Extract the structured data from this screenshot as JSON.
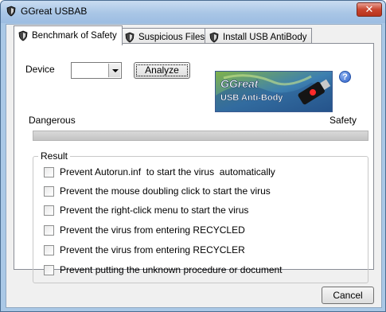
{
  "window": {
    "title": "GGreat USBAB",
    "close_glyph": "✕"
  },
  "tabs": [
    {
      "label": "Benchmark of Safety",
      "active": true,
      "icon": "shield-icon"
    },
    {
      "label": "Suspicious Files",
      "active": false,
      "icon": "shield-icon"
    },
    {
      "label": "Install USB AntiBody",
      "active": false,
      "icon": "shield-icon"
    }
  ],
  "benchmark": {
    "device_label": "Device",
    "device_value": "",
    "analyze_label": "Analyze",
    "banner": {
      "line1": "GGreat",
      "line2": "USB Anti-Body"
    },
    "help_glyph": "?",
    "scale_left": "Dangerous",
    "scale_right": "Safety",
    "safety_level": 0,
    "result_title": "Result",
    "checks": [
      {
        "label": "Prevent Autorun.inf  to start the virus  automatically",
        "checked": false
      },
      {
        "label": "Prevent the mouse doubling click to start the virus",
        "checked": false
      },
      {
        "label": "Prevent the right-click menu to start the virus",
        "checked": false
      },
      {
        "label": "Prevent the virus from entering RECYCLED",
        "checked": false
      },
      {
        "label": "Prevent the virus from entering RECYCLER",
        "checked": false
      },
      {
        "label": "Prevent putting the unknown procedure or document",
        "checked": false
      }
    ]
  },
  "footer": {
    "cancel_label": "Cancel"
  }
}
